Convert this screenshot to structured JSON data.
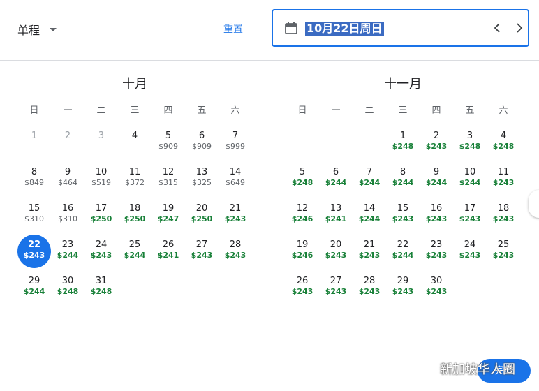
{
  "header": {
    "trip_type": "单程",
    "reset": "重置",
    "date_value": "10月22日周日"
  },
  "months": [
    {
      "title": "十月",
      "weekdays": [
        "日",
        "一",
        "二",
        "三",
        "四",
        "五",
        "六"
      ],
      "offset": 0,
      "days": [
        {
          "n": "1",
          "p": "",
          "past": true
        },
        {
          "n": "2",
          "p": "",
          "past": true
        },
        {
          "n": "3",
          "p": "",
          "past": true
        },
        {
          "n": "4",
          "p": ""
        },
        {
          "n": "5",
          "p": "$909"
        },
        {
          "n": "6",
          "p": "$909"
        },
        {
          "n": "7",
          "p": "$999"
        },
        {
          "n": "8",
          "p": "$849"
        },
        {
          "n": "9",
          "p": "$464"
        },
        {
          "n": "10",
          "p": "$519"
        },
        {
          "n": "11",
          "p": "$372"
        },
        {
          "n": "12",
          "p": "$315"
        },
        {
          "n": "13",
          "p": "$325"
        },
        {
          "n": "14",
          "p": "$649"
        },
        {
          "n": "15",
          "p": "$310"
        },
        {
          "n": "16",
          "p": "$310"
        },
        {
          "n": "17",
          "p": "$250",
          "low": true
        },
        {
          "n": "18",
          "p": "$250",
          "low": true
        },
        {
          "n": "19",
          "p": "$247",
          "low": true
        },
        {
          "n": "20",
          "p": "$250",
          "low": true
        },
        {
          "n": "21",
          "p": "$243",
          "low": true
        },
        {
          "n": "22",
          "p": "$243",
          "low": true,
          "selected": true
        },
        {
          "n": "23",
          "p": "$244",
          "low": true
        },
        {
          "n": "24",
          "p": "$243",
          "low": true
        },
        {
          "n": "25",
          "p": "$244",
          "low": true
        },
        {
          "n": "26",
          "p": "$241",
          "low": true
        },
        {
          "n": "27",
          "p": "$243",
          "low": true
        },
        {
          "n": "28",
          "p": "$243",
          "low": true
        },
        {
          "n": "29",
          "p": "$244",
          "low": true
        },
        {
          "n": "30",
          "p": "$248",
          "low": true
        },
        {
          "n": "31",
          "p": "$248",
          "low": true
        }
      ]
    },
    {
      "title": "十一月",
      "weekdays": [
        "日",
        "一",
        "二",
        "三",
        "四",
        "五",
        "六"
      ],
      "offset": 3,
      "days": [
        {
          "n": "1",
          "p": "$248",
          "low": true
        },
        {
          "n": "2",
          "p": "$243",
          "low": true
        },
        {
          "n": "3",
          "p": "$248",
          "low": true
        },
        {
          "n": "4",
          "p": "$248",
          "low": true
        },
        {
          "n": "5",
          "p": "$248",
          "low": true
        },
        {
          "n": "6",
          "p": "$244",
          "low": true
        },
        {
          "n": "7",
          "p": "$244",
          "low": true
        },
        {
          "n": "8",
          "p": "$244",
          "low": true
        },
        {
          "n": "9",
          "p": "$244",
          "low": true
        },
        {
          "n": "10",
          "p": "$244",
          "low": true
        },
        {
          "n": "11",
          "p": "$243",
          "low": true
        },
        {
          "n": "12",
          "p": "$246",
          "low": true
        },
        {
          "n": "13",
          "p": "$241",
          "low": true
        },
        {
          "n": "14",
          "p": "$244",
          "low": true
        },
        {
          "n": "15",
          "p": "$243",
          "low": true
        },
        {
          "n": "16",
          "p": "$243",
          "low": true
        },
        {
          "n": "17",
          "p": "$243",
          "low": true
        },
        {
          "n": "18",
          "p": "$243",
          "low": true
        },
        {
          "n": "19",
          "p": "$246",
          "low": true
        },
        {
          "n": "20",
          "p": "$243",
          "low": true
        },
        {
          "n": "21",
          "p": "$243",
          "low": true
        },
        {
          "n": "22",
          "p": "$244",
          "low": true
        },
        {
          "n": "23",
          "p": "$243",
          "low": true
        },
        {
          "n": "24",
          "p": "$243",
          "low": true
        },
        {
          "n": "25",
          "p": "$243",
          "low": true
        },
        {
          "n": "26",
          "p": "$243",
          "low": true
        },
        {
          "n": "27",
          "p": "$243",
          "low": true
        },
        {
          "n": "28",
          "p": "$243",
          "low": true
        },
        {
          "n": "29",
          "p": "$243",
          "low": true
        },
        {
          "n": "30",
          "p": "$243",
          "low": true
        }
      ]
    }
  ],
  "footer": {
    "done": "完成",
    "watermark": "新加坡华人圈"
  },
  "colors": {
    "accent": "#1a73e8",
    "low_price": "#188038",
    "regular_price": "#5f6368",
    "past_day": "#9aa0a6"
  },
  "icons": [
    "calendar-icon",
    "chevron-left-icon",
    "chevron-right-icon",
    "dropdown-caret-icon",
    "wechat-icon"
  ]
}
